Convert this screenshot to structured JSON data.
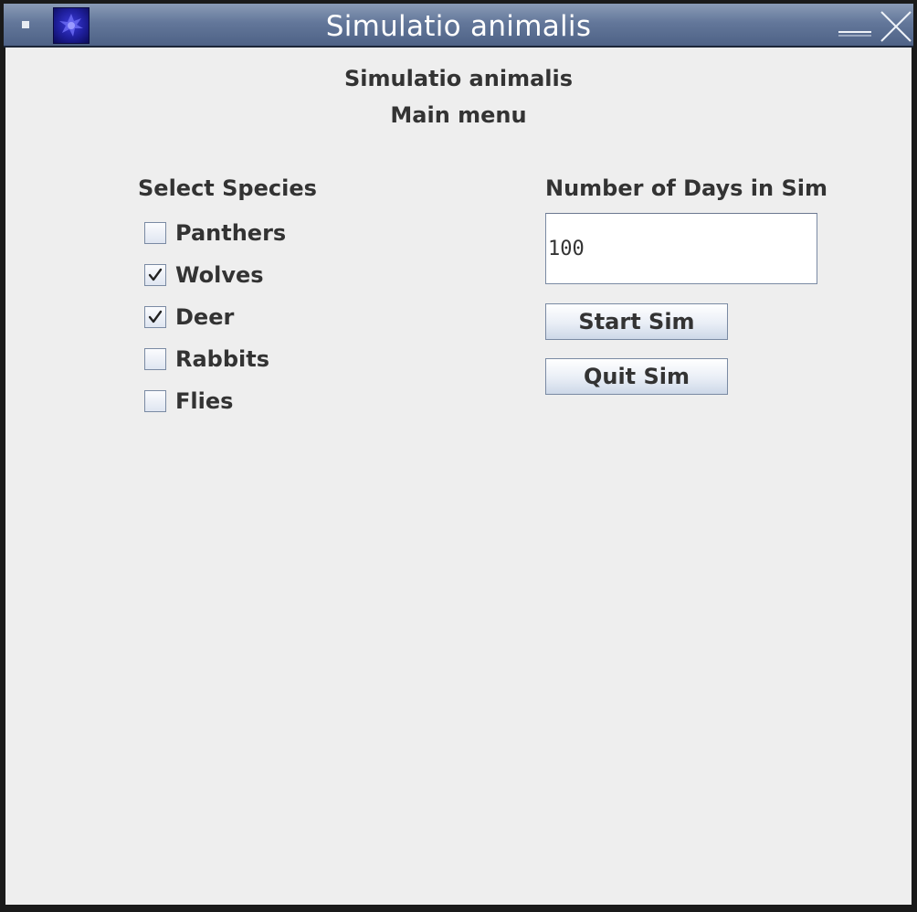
{
  "window": {
    "title": "Simulatio animalis"
  },
  "header": {
    "title": "Simulatio animalis",
    "subtitle": "Main menu"
  },
  "species": {
    "heading": "Select Species",
    "items": [
      {
        "label": "Panthers",
        "checked": false
      },
      {
        "label": "Wolves",
        "checked": true
      },
      {
        "label": "Deer",
        "checked": true
      },
      {
        "label": "Rabbits",
        "checked": false
      },
      {
        "label": "Flies",
        "checked": false
      }
    ]
  },
  "days": {
    "heading": "Number of Days in Sim",
    "value": "100"
  },
  "buttons": {
    "start_label": "Start Sim",
    "quit_label": "Quit Sim"
  },
  "icons": {
    "window_menu": "window-menu-icon",
    "app": "app-icon",
    "minimize": "minimize-icon",
    "close": "close-icon",
    "checkmark": "checkmark-icon"
  },
  "colors": {
    "titlebar": "#63779a",
    "content_background": "#eeeeee",
    "text": "#333333",
    "control_border": "#7a8aa3"
  }
}
